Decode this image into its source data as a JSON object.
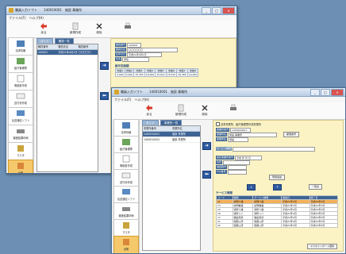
{
  "window1": {
    "title": "職員入力ソフト　　140010001　施設 事業所",
    "menu": [
      "ファイル(F)",
      "ヘルプ(H)"
    ],
    "toolbar": [
      {
        "label": "戻る",
        "icon": "back-arrow-icon"
      },
      {
        "label": "新規作成",
        "icon": "new-document-icon"
      },
      {
        "label": "削除",
        "icon": "delete-x-icon"
      },
      {
        "label": "",
        "icon": "print-icon"
      }
    ],
    "sidebar": [
      {
        "label": "請求情報",
        "icon": "billing-icon"
      },
      {
        "label": "給付管理票",
        "icon": "benefit-icon"
      },
      {
        "label": "明細書作成",
        "icon": "statement-icon"
      },
      {
        "label": "送付状作成",
        "icon": "cover-letter-icon"
      },
      {
        "label": "伝送通信ソフト",
        "icon": "transfer-icon"
      },
      {
        "label": "審査結果印刷",
        "icon": "print-result-icon"
      },
      {
        "label": "マスタ",
        "icon": "master-icon"
      },
      {
        "label": "台帳",
        "icon": "ledger-icon"
      }
    ],
    "tabs": [
      "ガイド",
      "職員一覧"
    ],
    "list": {
      "headers": [
        "職員番号",
        "職員氏名",
        "職員番号"
      ],
      "rows": [
        [
          "100001",
          "平成21年4月1日",
          "〇〇〇〇〇"
        ]
      ]
    },
    "form": {
      "fields": [
        {
          "label": "職員番号",
          "value": "100001"
        },
        {
          "label": "職員氏名",
          "value": "〇〇〇〇〇〇"
        },
        {
          "label": "生年月日",
          "value": "平成21年4月1日"
        },
        {
          "label": "性別",
          "value": "男性"
        }
      ],
      "section": "給与支給額",
      "section2": "保険料控除額",
      "grid_headers": [
        "支給1",
        "支給2",
        "支給3",
        "支給4",
        "支給5",
        "支給6",
        "支給7",
        "支給8"
      ],
      "grid_values": [
        "3,000",
        "3,000",
        "15,455",
        "10,000",
        "15,615",
        "15,015",
        "30,365",
        "10,000"
      ]
    }
  },
  "window2": {
    "title": "職員入力ソフト　　140010001　施設 事業所",
    "menu": [
      "ファイル(F)",
      "ヘルプ(H)"
    ],
    "toolbar": [
      {
        "label": "戻る",
        "icon": "back-arrow-icon"
      },
      {
        "label": "新規作成",
        "icon": "new-document-icon"
      },
      {
        "label": "削除",
        "icon": "delete-x-icon"
      },
      {
        "label": "",
        "icon": "print-icon"
      }
    ],
    "sidebar": [
      {
        "label": "請求情報",
        "icon": "billing-icon"
      },
      {
        "label": "給付管理票",
        "icon": "benefit-icon"
      },
      {
        "label": "明細書作成",
        "icon": "statement-icon"
      },
      {
        "label": "送付状作成",
        "icon": "cover-letter-icon"
      },
      {
        "label": "伝送通信ソフト",
        "icon": "transfer-icon"
      },
      {
        "label": "審査結果印刷",
        "icon": "print-result-icon"
      },
      {
        "label": "マスタ",
        "icon": "master-icon"
      },
      {
        "label": "台帳",
        "icon": "ledger-icon"
      }
    ],
    "tabs": [
      "ガイド",
      "事業所一覧"
    ],
    "list": {
      "headers": [
        "事業所番号",
        "事業所名"
      ],
      "rows": [
        [
          "1400010001",
          "施設 事業所"
        ],
        [
          "1400010002",
          "施設 事業所"
        ]
      ]
    },
    "form": {
      "checkbox_label": "請求事業所、給付管理票作成事業所",
      "fields": [
        {
          "label": "事業所番号",
          "value": "1400010001"
        },
        {
          "label": "事業所名",
          "value": "施設 事業所"
        },
        {
          "label": "事業所名",
          "value": "施設"
        }
      ],
      "zip_button": "郵便番号",
      "service_type_label": "サービス種類",
      "service_type_value": "",
      "rows": [
        {
          "label": "指定事業所番号",
          "value": "平成 年 月 日"
        },
        {
          "label": "住所",
          "value": ""
        },
        {
          "label": "電話番号",
          "value": ""
        },
        {
          "label": "FAX番号",
          "value": ""
        }
      ],
      "register_button": "登録追加",
      "down_button": "↓",
      "up_button": "↑",
      "list_button": "一覧表",
      "service_section": "サービス情報",
      "service_headers": [
        "コード",
        "種類",
        "サービス種類",
        "開始日",
        "終了日"
      ],
      "service_rows": [
        [
          "11",
          "訪問介護",
          "訪問介護",
          "平成21年4月",
          "平成22年3月"
        ],
        [
          "13",
          "訪問看護",
          "訪問看護",
          "平成21年4月",
          "平成22年3月"
        ],
        [
          "15",
          "通所介護",
          "通所介護",
          "平成21年4月",
          "平成22年3月"
        ],
        [
          "16",
          "通所リハ",
          "通所リハ",
          "平成21年4月",
          "平成22年3月"
        ],
        [
          "17",
          "福祉用具",
          "福祉用具",
          "平成21年4月",
          "平成22年3月"
        ],
        [
          "21",
          "短期入所",
          "短期入所",
          "平成21年4月",
          "平成22年3月"
        ],
        [
          "22",
          "短期入所",
          "短期入所",
          "平成21年4月",
          "平成22年3月"
        ]
      ],
      "bottom_button": "マスタインポート更新"
    }
  }
}
